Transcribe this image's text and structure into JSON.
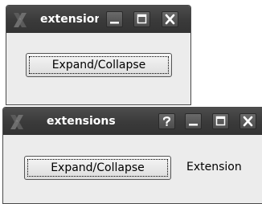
{
  "windows": [
    {
      "title": "extensions",
      "buttons": [
        "minimize",
        "maximize",
        "close"
      ],
      "toggle_button_label": "Expand/Collapse"
    },
    {
      "title": "extensions",
      "buttons": [
        "help",
        "minimize",
        "maximize",
        "close"
      ],
      "toggle_button_label": "Expand/Collapse",
      "extension_label": "Extension"
    }
  ],
  "icons": {
    "app_logo": "x-logo-icon",
    "help": "question-mark-icon",
    "minimize": "minimize-icon",
    "maximize": "maximize-icon",
    "close": "close-icon"
  },
  "colors": {
    "titlebar": "#3a3a3a",
    "window_body": "#ececec",
    "border": "#4a4a4a",
    "title_text": "#ffffff"
  }
}
